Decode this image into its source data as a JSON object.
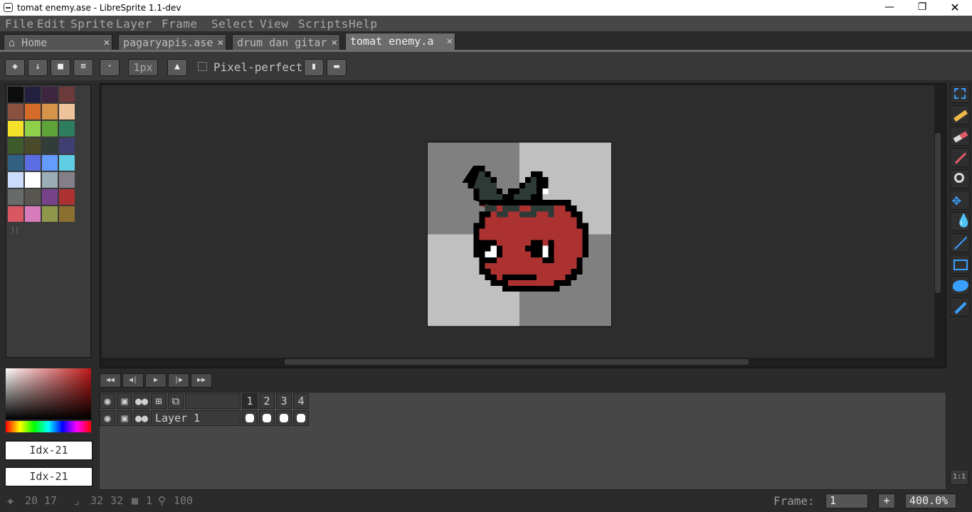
{
  "window": {
    "title": "tomat enemy.ase - LibreSprite 1.1-dev"
  },
  "menu": [
    "File",
    "Edit",
    "Sprite",
    "Layer",
    "Frame",
    "Select",
    "View",
    "Scripts",
    "Help"
  ],
  "tabs": [
    {
      "label": "Home",
      "active": false
    },
    {
      "label": "pagaryapis.ase",
      "active": false
    },
    {
      "label": "drum dan gitar",
      "active": false
    },
    {
      "label": "tomat enemy.a",
      "active": true
    }
  ],
  "toolbar": {
    "brush_size": "1px",
    "pixel_perfect_label": "Pixel-perfect",
    "pixel_perfect_checked": false
  },
  "palette": [
    "#0d0d0d",
    "#232040",
    "#3d2540",
    "#6b3a3a",
    "#8a5040",
    "#d66a28",
    "#d6944a",
    "#eec39a",
    "#f6e12a",
    "#8fd04a",
    "#5ea33a",
    "#2e7d5e",
    "#3d5a2a",
    "#4a4a2a",
    "#323c39",
    "#3f3f74",
    "#306082",
    "#5b6ee1",
    "#639bff",
    "#5fcde4",
    "#cbdbfc",
    "#ffffff",
    "#9badb7",
    "#847e87",
    "#696a6a",
    "#595652",
    "#76428a",
    "#ac3232",
    "#d95763",
    "#d77bba",
    "#8f974a",
    "#8a6f30"
  ],
  "colors": {
    "fg_label": "Idx-21",
    "bg_label": "Idx-21"
  },
  "layers": [
    {
      "name": "Layer 1"
    }
  ],
  "frames": [
    "1",
    "2",
    "3",
    "4"
  ],
  "status": {
    "pos_x": "20",
    "pos_y": "17",
    "size_w": "32",
    "size_h": "32",
    "frames": "1",
    "opacity": "100",
    "frame_label": "Frame:",
    "frame_value": "1",
    "zoom": "400.0%"
  },
  "zoom_reset_label": "1:1"
}
